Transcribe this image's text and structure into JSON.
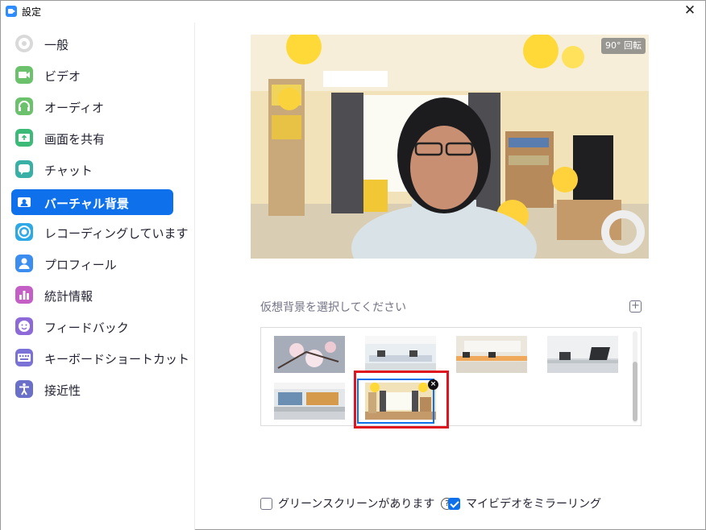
{
  "window": {
    "title": "設定",
    "close_glyph": "✕"
  },
  "sidebar": {
    "items": [
      {
        "label": "一般",
        "icon": "gear-icon",
        "color": "#d9d9d9",
        "active": false
      },
      {
        "label": "ビデオ",
        "icon": "video-icon",
        "color": "#6cc26c",
        "active": false
      },
      {
        "label": "オーディオ",
        "icon": "headphones-icon",
        "color": "#6cc26c",
        "active": false
      },
      {
        "label": "画面を共有",
        "icon": "share-screen-icon",
        "color": "#3cba78",
        "active": false
      },
      {
        "label": "チャット",
        "icon": "chat-icon",
        "color": "#39b0a6",
        "active": false
      },
      {
        "label": "バーチャル背景",
        "icon": "virtual-background-icon",
        "color": "#ffffff",
        "active": true
      },
      {
        "label": "レコーディングしています",
        "icon": "record-icon",
        "color": "#2ea9e6",
        "active": false
      },
      {
        "label": "プロフィール",
        "icon": "profile-icon",
        "color": "#3b8df0",
        "active": false
      },
      {
        "label": "統計情報",
        "icon": "statistics-icon",
        "color": "#c45fc5",
        "active": false
      },
      {
        "label": "フィードバック",
        "icon": "feedback-icon",
        "color": "#8e6ad8",
        "active": false
      },
      {
        "label": "キーボードショートカット",
        "icon": "keyboard-icon",
        "color": "#7a72d6",
        "active": false
      },
      {
        "label": "接近性",
        "icon": "accessibility-icon",
        "color": "#6a6fc8",
        "active": false
      }
    ]
  },
  "preview": {
    "rotate_label": "90° 回転"
  },
  "background_section": {
    "label": "仮想背景を選択してください",
    "add_glyph": "+",
    "thumbnails": [
      {
        "name": "cherry-blossom",
        "selected": false
      },
      {
        "name": "office-1",
        "selected": false
      },
      {
        "name": "office-2",
        "selected": false
      },
      {
        "name": "office-3",
        "selected": false
      },
      {
        "name": "office-4",
        "selected": false
      },
      {
        "name": "living-room",
        "selected": true
      }
    ],
    "remove_glyph": "×"
  },
  "options": {
    "green_screen": {
      "label": "グリーンスクリーンがあります",
      "checked": false,
      "help_glyph": "?"
    },
    "mirror_video": {
      "label": "マイビデオをミラーリング",
      "checked": true
    }
  },
  "colors": {
    "accent": "#0e71eb",
    "highlight": "#e0141e"
  }
}
